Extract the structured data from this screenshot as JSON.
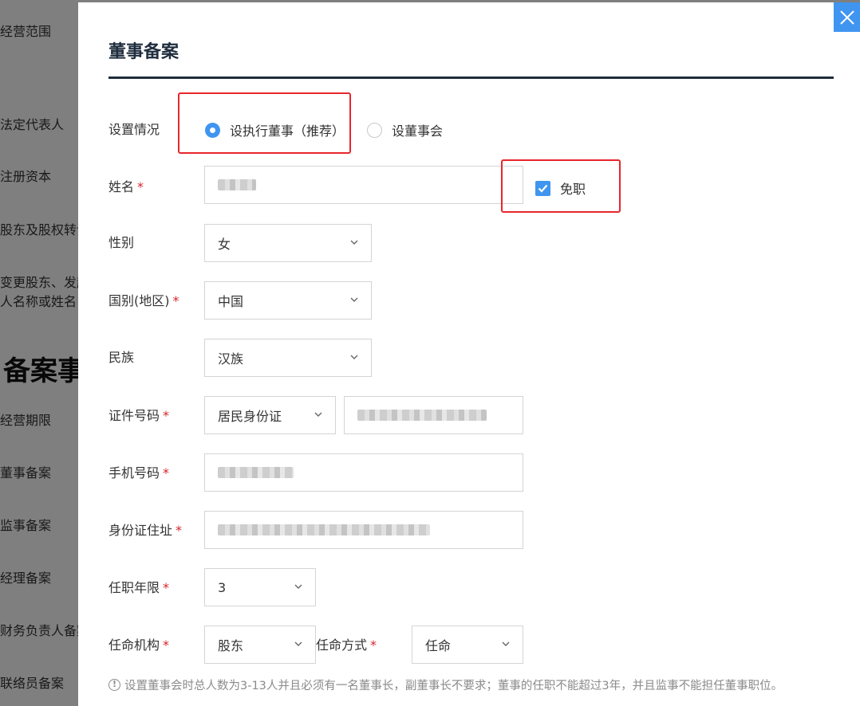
{
  "background": {
    "nav_items": [
      {
        "label": "经营范围"
      },
      {
        "label": "法定代表人"
      },
      {
        "label": "注册资本"
      },
      {
        "label": "股东及股权转让"
      },
      {
        "label": "变更股东、发起"
      },
      {
        "label": "人名称或姓名"
      },
      {
        "label": "经营期限"
      },
      {
        "label": "董事备案"
      },
      {
        "label": "监事备案"
      },
      {
        "label": "经理备案"
      },
      {
        "label": "财务负责人备案"
      },
      {
        "label": "联络员备案"
      }
    ],
    "section_heading": "备案事"
  },
  "modal": {
    "title": "董事备案",
    "setup": {
      "label": "设置情况",
      "options": [
        {
          "label": "设执行董事（推荐）",
          "checked": true
        },
        {
          "label": "设董事会",
          "checked": false
        }
      ]
    },
    "name": {
      "label": "姓名",
      "required_mark": "*",
      "value_redacted": true
    },
    "dismiss": {
      "label": "免职",
      "checked": true
    },
    "gender": {
      "label": "性别",
      "value": "女"
    },
    "nationality": {
      "label": "国别(地区)",
      "required_mark": "*",
      "value": "中国"
    },
    "ethnicity": {
      "label": "民族",
      "value": "汉族"
    },
    "id_number": {
      "label": "证件号码",
      "required_mark": "*",
      "type_value": "居民身份证",
      "value_redacted": true
    },
    "phone": {
      "label": "手机号码",
      "required_mark": "*",
      "value_redacted": true
    },
    "id_address": {
      "label": "身份证住址",
      "required_mark": "*",
      "value_redacted": true
    },
    "term": {
      "label": "任职年限",
      "required_mark": "*",
      "value": "3"
    },
    "appointing_body": {
      "label": "任命机构",
      "required_mark": "*",
      "value": "股东"
    },
    "appointment_method": {
      "label": "任命方式",
      "required_mark": "*",
      "value": "任命"
    },
    "hint": {
      "icon": "!",
      "text": "设置董事会时总人数为3-13人并且必须有一名董事长，副董事长不要求；董事的任职不能超过3年，并且监事不能担任董事职位。"
    }
  },
  "colors": {
    "accent": "#3f95f0",
    "required": "#d8232a",
    "highlight_box": "#e8262c",
    "title_rule": "#1f2d3d"
  },
  "icons": {
    "close": "close-icon",
    "chevron": "chevron-down-icon",
    "check": "check-icon",
    "info": "info-circle-icon"
  }
}
